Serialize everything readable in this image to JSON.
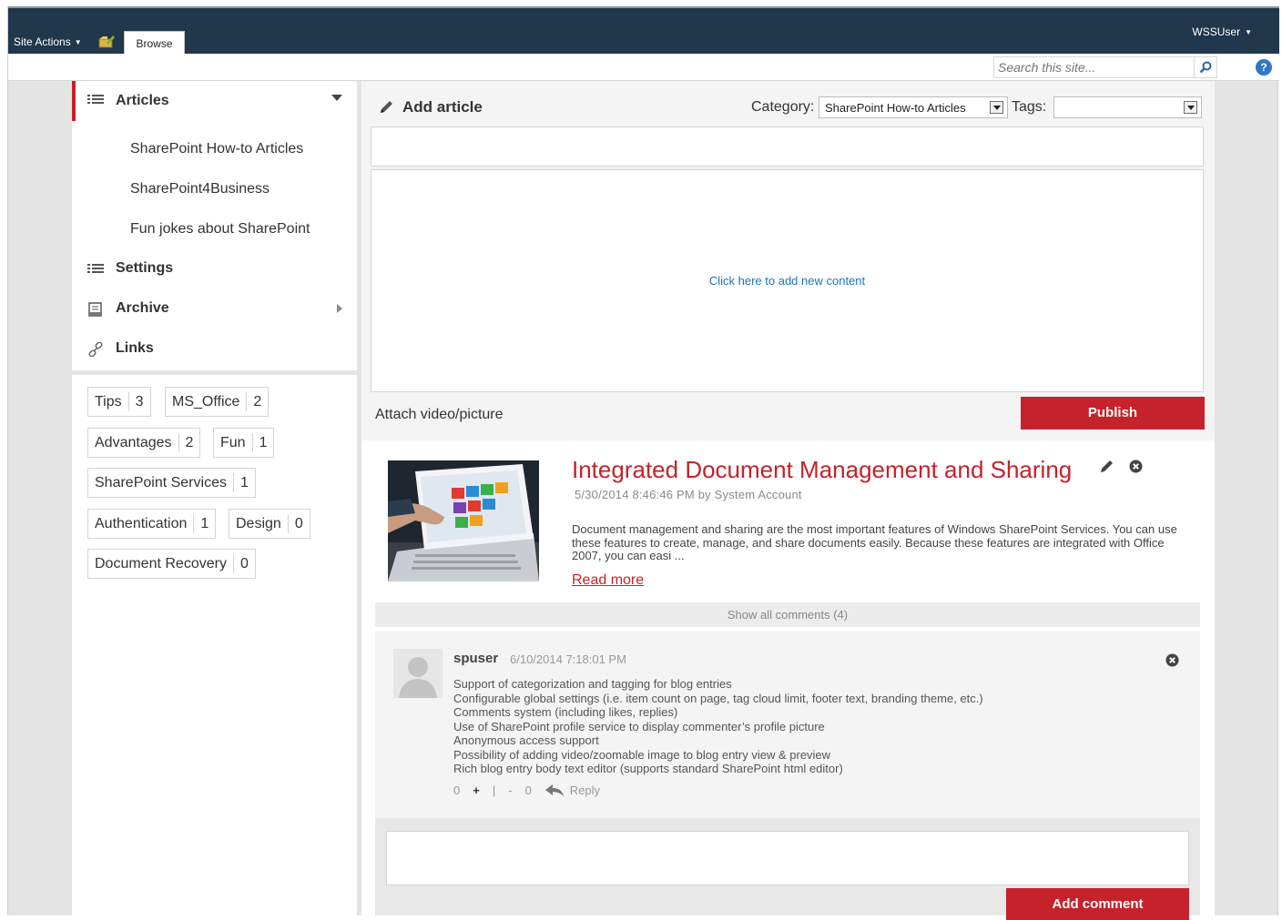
{
  "ribbon": {
    "site_actions": "Site Actions",
    "browse_tab": "Browse",
    "user": "WSSUser"
  },
  "search": {
    "placeholder": "Search this site..."
  },
  "left_nav": {
    "articles": "Articles",
    "articles_items": [
      "SharePoint How-to Articles",
      "SharePoint4Business",
      "Fun jokes about SharePoint"
    ],
    "settings": "Settings",
    "archive": "Archive",
    "links": "Links"
  },
  "tags": [
    {
      "name": "Tips",
      "count": "3"
    },
    {
      "name": "MS_Office",
      "count": "2"
    },
    {
      "name": "Advantages",
      "count": "2"
    },
    {
      "name": "Fun",
      "count": "1"
    },
    {
      "name": "SharePoint Services",
      "count": "1"
    },
    {
      "name": "Authentication",
      "count": "1"
    },
    {
      "name": "Design",
      "count": "0"
    },
    {
      "name": "Document Recovery",
      "count": "0"
    }
  ],
  "compose": {
    "title": "Add article",
    "category_label": "Category:",
    "category_value": "SharePoint How-to Articles",
    "tags_label": "Tags:",
    "tags_value": "",
    "add_content": "Click here to add new content",
    "attach": "Attach video/picture",
    "publish": "Publish"
  },
  "post": {
    "title": "Integrated Document Management and Sharing",
    "meta": "5/30/2014 8:46:46 PM by System Account",
    "excerpt": "Document management and sharing are the most important features of Windows SharePoint Services. You can use these features to create,   manage, and share documents easily. Because these features are integrated with Office 2007, you can easi ...",
    "read_more": "Read more",
    "show_comments": "Show all comments (4)"
  },
  "comment": {
    "author": "spuser",
    "date": "6/10/2014 7:18:01 PM",
    "lines": [
      "Support of categorization and tagging for blog entries",
      "Configurable global settings (i.e. item count on page, tag cloud limit, footer text, branding theme, etc.)",
      "Comments system (including likes, replies)",
      "Use of SharePoint profile service to display commenter’s profile picture",
      "Anonymous access support",
      "Possibility of adding video/zoomable image to blog entry view & preview",
      "Rich blog entry body text editor (supports standard SharePoint html editor)"
    ],
    "likes": "0",
    "plus": "+",
    "sep": "|",
    "minus": "-",
    "dislikes": "0",
    "reply": "Reply"
  },
  "comment_form": {
    "add_comment": "Add comment"
  },
  "colors": {
    "accent_red": "#c5222b",
    "ribbon": "#21374c",
    "link_blue": "#1f73b7"
  }
}
